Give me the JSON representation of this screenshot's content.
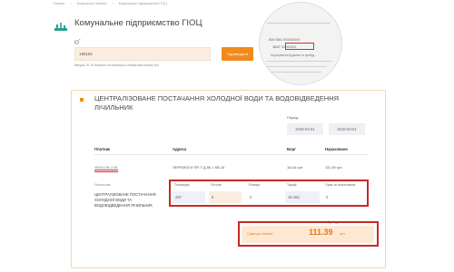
{
  "breadcrumbs": [
    "Платежі",
    "Комунальні платежі",
    "Комунальне підприємство ГІОЦ"
  ],
  "page_title": "Комунальне підприємство ГІОЦ",
  "id_field": {
    "label": "ID",
    "value": "196181"
  },
  "confirm_button": "Підтвердити",
  "hint": "Введіть ID, ID вказано на квитанції в лівому верхньому куті",
  "receipt_image": {
    "top_text": "000 000 XXXXXXX",
    "mid_text": "1697 XXXXXX",
    "subtitle": "Нарахування будинків та прибуд..."
  },
  "service": {
    "title": "ЦЕНТРАЛІЗОВАНЕ ПОСТАЧАННЯ ХОЛОДНОЇ ВОДИ ТА ВОДОВІДВЕДЕННЯ ЛІЧИЛЬНИК",
    "period_label": "Період",
    "period_from": "2018-02-01",
    "period_to": "2018-03-01"
  },
  "table": {
    "headers": {
      "payer": "Платник",
      "address": "Адреса",
      "debt": "Борг",
      "accrued": "Нараховано"
    },
    "row": {
      "payer": "УКИСОВ О.М.",
      "address": "ПЕРЕМОГИ ПР-Т Д.56 1 КВ.15",
      "debt": "18.44 грн",
      "accrued": "111.39 грн"
    }
  },
  "meters": {
    "section_label": "Лічильник",
    "service_name": "ЦЕНТРАЛІЗОВАНЕ ПОСТАЧАННЯ ХОЛОДНОЇ ВОДИ ТА ВОДОВІДВЕДЕННЯ ЛІЧИЛЬНИК",
    "labels": {
      "previous": "Попередні",
      "current": "Поточні",
      "difference": "Різниця",
      "tariff": "Тариф",
      "sum_by_meter": "Сума за лічильником"
    },
    "values": {
      "previous": "287",
      "current": "8",
      "difference": "0",
      "tariff": "15.492",
      "sum_by_meter": "0"
    }
  },
  "sum_to_pay": {
    "label": "Сума до сплати",
    "value": "111.39"
  },
  "total": {
    "label": "Сума до сплати:",
    "amount": "111.39",
    "currency": "грн"
  },
  "colors": {
    "accent": "#f08a1c",
    "highlight_frame": "#c62828"
  }
}
